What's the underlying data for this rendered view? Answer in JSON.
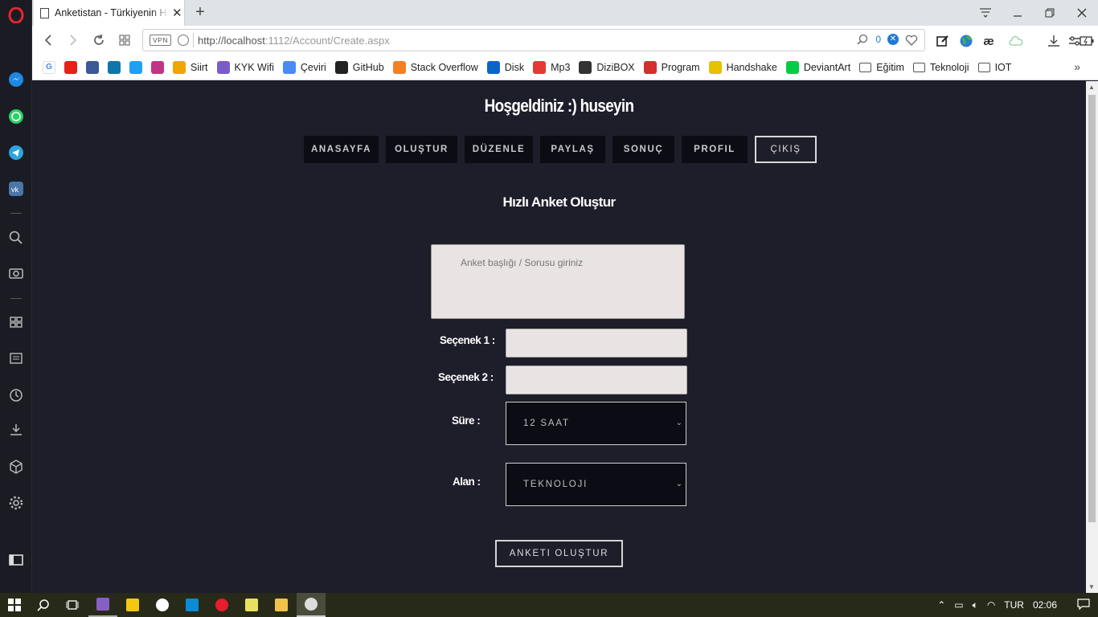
{
  "browser": {
    "tab_title": "Anketistan - Türkiyenin Hızlı",
    "url_host": "http://localhost",
    "url_path": ":1112/Account/Create.aspx",
    "vpn_label": "VPN",
    "ad_block_count": "0"
  },
  "bookmarks": [
    {
      "label": "",
      "icon": "google-icon",
      "color": "#ffffff"
    },
    {
      "label": "",
      "icon": "youtube-icon",
      "color": "#e62117"
    },
    {
      "label": "",
      "icon": "facebook-icon",
      "color": "#3b5998"
    },
    {
      "label": "",
      "icon": "linkedin-icon",
      "color": "#0e76a8"
    },
    {
      "label": "",
      "icon": "twitter-icon",
      "color": "#1da1f2"
    },
    {
      "label": "",
      "icon": "instagram-icon",
      "color": "#c13584"
    },
    {
      "label": "Siirt",
      "icon": "siirt-icon",
      "color": "#f0a500"
    },
    {
      "label": "KYK Wifi",
      "icon": "kyk-icon",
      "color": "#7a5cc9"
    },
    {
      "label": "Çeviri",
      "icon": "translate-icon",
      "color": "#4a8af4"
    },
    {
      "label": "GitHub",
      "icon": "github-icon",
      "color": "#222222"
    },
    {
      "label": "Stack Overflow",
      "icon": "stackoverflow-icon",
      "color": "#f48024"
    },
    {
      "label": "Disk",
      "icon": "disk-icon",
      "color": "#0a64c8"
    },
    {
      "label": "Mp3",
      "icon": "mp3-icon",
      "color": "#e53935"
    },
    {
      "label": "DiziBOX",
      "icon": "dizibox-icon",
      "color": "#333333"
    },
    {
      "label": "Program",
      "icon": "program-icon",
      "color": "#d32f2f"
    },
    {
      "label": "Handshake",
      "icon": "handshake-icon",
      "color": "#e6c200"
    },
    {
      "label": "DeviantArt",
      "icon": "deviantart-icon",
      "color": "#05cc47"
    },
    {
      "label": "Eğitim",
      "icon": "folder-icon",
      "color": "#555555"
    },
    {
      "label": "Teknoloji",
      "icon": "folder-icon",
      "color": "#555555"
    },
    {
      "label": "IOT",
      "icon": "folder-icon",
      "color": "#555555"
    }
  ],
  "page": {
    "welcome": "Hoşgeldiniz :) huseyin",
    "menu": [
      "ANASAYFA",
      "OLUŞTUR",
      "DÜZENLE",
      "PAYLAŞ",
      "SONUÇ",
      "PROFIL",
      "ÇIKIŞ"
    ],
    "form_title": "Hızlı Anket Oluştur",
    "question_placeholder": "Anket başlığı / Sorusu giriniz",
    "option1_label": "Seçenek 1 :",
    "option2_label": "Seçenek 2 :",
    "duration_label": "Süre :",
    "duration_value": "12 SAAT",
    "category_label": "Alan :",
    "category_value": "TEKNOLOJI",
    "submit_label": "ANKETI OLUŞTUR"
  },
  "taskbar": {
    "language": "TUR",
    "time": "02:06"
  }
}
